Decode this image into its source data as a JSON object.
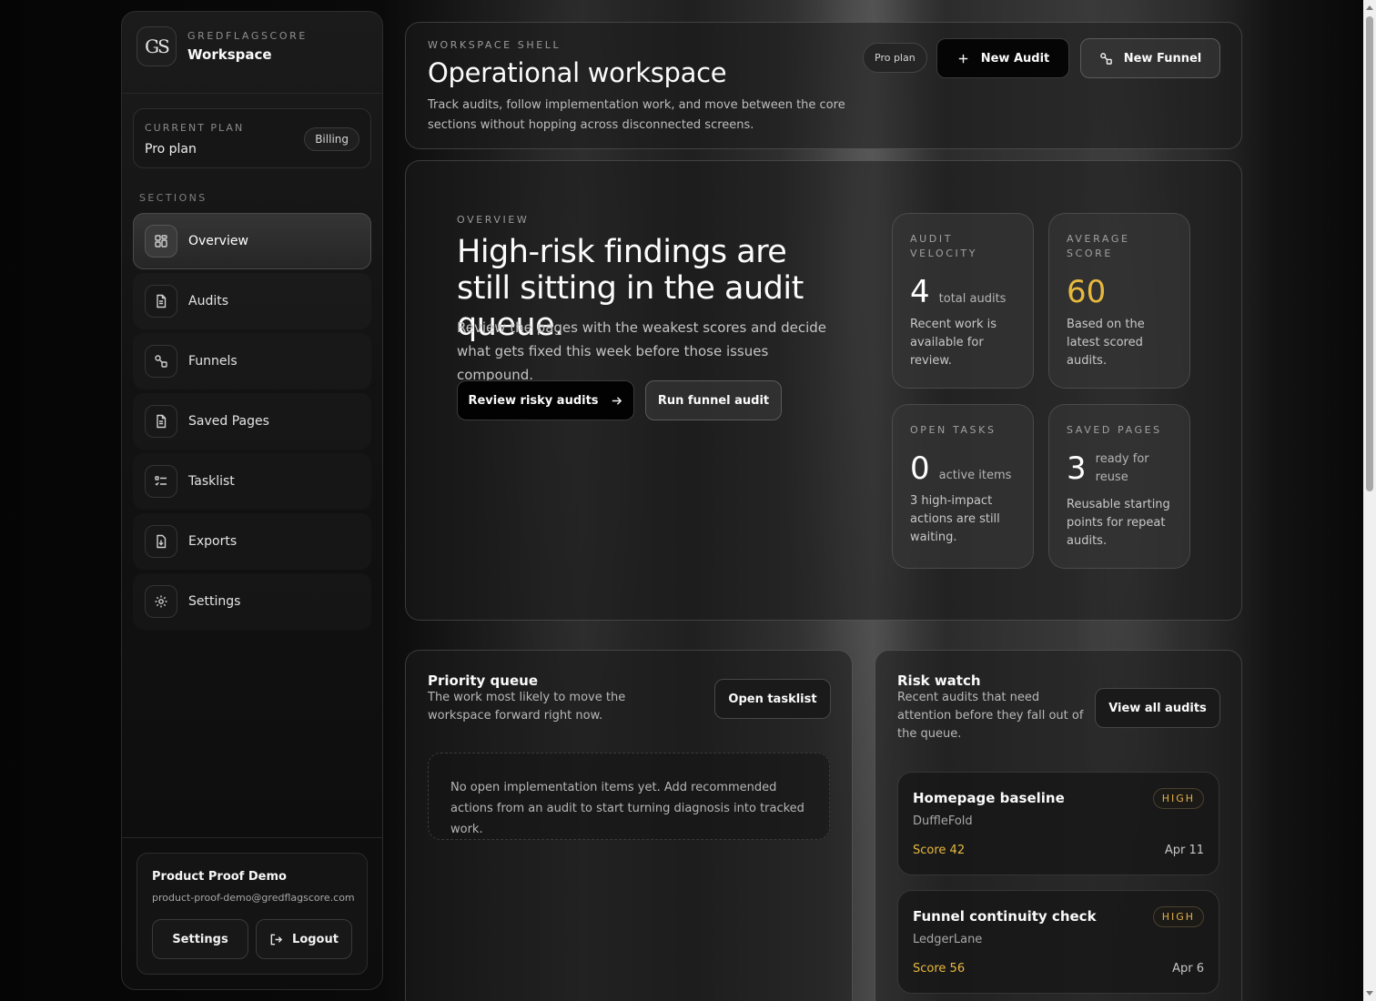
{
  "brand": {
    "kicker": "GREDFLAGSCORE",
    "title": "Workspace",
    "logo_text": "GS"
  },
  "plan": {
    "kicker": "CURRENT PLAN",
    "name": "Pro plan",
    "billing_label": "Billing"
  },
  "sidebar": {
    "sections_label": "SECTIONS",
    "items": [
      {
        "label": "Overview",
        "icon": "overview-grid-icon",
        "active": true
      },
      {
        "label": "Audits",
        "icon": "document-icon"
      },
      {
        "label": "Funnels",
        "icon": "funnel-nodes-icon"
      },
      {
        "label": "Saved Pages",
        "icon": "saved-page-icon"
      },
      {
        "label": "Tasklist",
        "icon": "checklist-icon"
      },
      {
        "label": "Exports",
        "icon": "export-icon"
      },
      {
        "label": "Settings",
        "icon": "gear-icon"
      }
    ]
  },
  "user": {
    "name": "Product Proof Demo",
    "email": "product-proof-demo@gredflagscore.com",
    "settings_label": "Settings",
    "logout_label": "Logout"
  },
  "header": {
    "kicker": "WORKSPACE SHELL",
    "title": "Operational workspace",
    "description": "Track audits, follow implementation work, and move between the core sections without hopping across disconnected screens.",
    "plan_pill": "Pro plan",
    "new_audit_label": "New Audit",
    "new_funnel_label": "New Funnel"
  },
  "overview": {
    "kicker": "OVERVIEW",
    "title": "High-risk findings are still sitting in the audit queue.",
    "description": "Review the pages with the weakest scores and decide what gets fixed this week before those issues compound.",
    "review_label": "Review risky audits",
    "run_label": "Run funnel audit",
    "stats": {
      "velocity": {
        "kicker": "AUDIT VELOCITY",
        "value": "4",
        "unit": "total audits",
        "desc": "Recent work is available for review."
      },
      "score": {
        "kicker": "AVERAGE SCORE",
        "value": "60",
        "desc": "Based on the latest scored audits.",
        "color": "#e7b93e"
      },
      "tasks": {
        "kicker": "OPEN TASKS",
        "value": "0",
        "unit": "active items",
        "desc": "3 high-impact actions are still waiting."
      },
      "saved": {
        "kicker": "SAVED PAGES",
        "value": "3",
        "unit": "ready for reuse",
        "desc": "Reusable starting points for repeat audits."
      }
    }
  },
  "queue": {
    "title": "Priority queue",
    "description": "The work most likely to move the workspace forward right now.",
    "open_label": "Open tasklist",
    "empty": "No open implementation items yet. Add recommended actions from an audit to start turning diagnosis into tracked work."
  },
  "risk": {
    "title": "Risk watch",
    "description": "Recent audits that need attention before they fall out of the queue.",
    "view_label": "View all audits",
    "items": [
      {
        "title": "Homepage baseline",
        "brand": "DuffleFold",
        "score": "Score 42",
        "date": "Apr 11",
        "badge": "HIGH"
      },
      {
        "title": "Funnel continuity check",
        "brand": "LedgerLane",
        "score": "Score 56",
        "date": "Apr 6",
        "badge": "HIGH"
      }
    ]
  },
  "colors": {
    "accent_gold": "#e7b93e",
    "background": "#0a0a0a"
  }
}
